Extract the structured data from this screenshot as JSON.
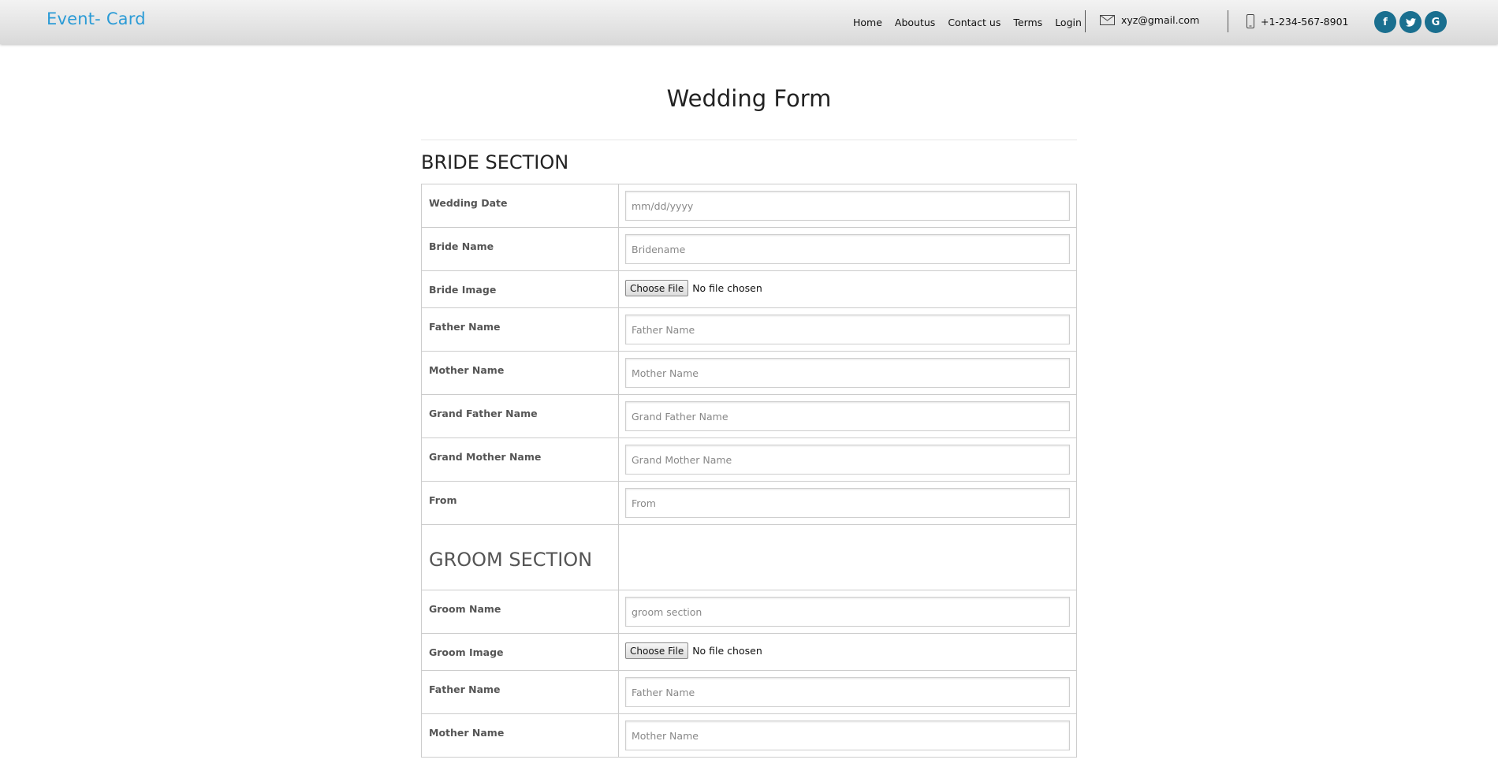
{
  "header": {
    "brand": "Event- Card",
    "nav": [
      "Home",
      "Aboutus",
      "Contact us",
      "Terms",
      "Login"
    ],
    "email": "xyz@gmail.com",
    "phone": "+1-234-567-8901",
    "social": [
      {
        "icon": "facebook-icon",
        "glyph": "f"
      },
      {
        "icon": "twitter-icon",
        "glyph": "t"
      },
      {
        "icon": "google-icon",
        "glyph": "G"
      }
    ],
    "accent_color": "#2b9bd6",
    "social_color": "#1a6f8f"
  },
  "page_title": "Wedding Form",
  "bride_section": {
    "heading": "BRIDE SECTION",
    "fields": [
      {
        "label": "Wedding Date",
        "placeholder": "mm/dd/yyyy"
      },
      {
        "label": "Bride Name",
        "placeholder": "Bridename"
      },
      {
        "label": "Bride Image",
        "button": "Choose File",
        "status": "No file chosen"
      },
      {
        "label": "Father Name",
        "placeholder": "Father Name"
      },
      {
        "label": "Mother Name",
        "placeholder": "Mother Name"
      },
      {
        "label": "Grand Father Name",
        "placeholder": "Grand Father Name"
      },
      {
        "label": "Grand Mother Name",
        "placeholder": "Grand Mother Name"
      },
      {
        "label": "From",
        "placeholder": "From"
      }
    ]
  },
  "groom_section": {
    "heading": "GROOM SECTION",
    "fields": [
      {
        "label": "Groom Name",
        "placeholder": "groom section"
      },
      {
        "label": "Groom Image",
        "button": "Choose File",
        "status": "No file chosen"
      },
      {
        "label": "Father Name",
        "placeholder": "Father Name"
      },
      {
        "label": "Mother Name",
        "placeholder": "Mother Name"
      }
    ]
  }
}
